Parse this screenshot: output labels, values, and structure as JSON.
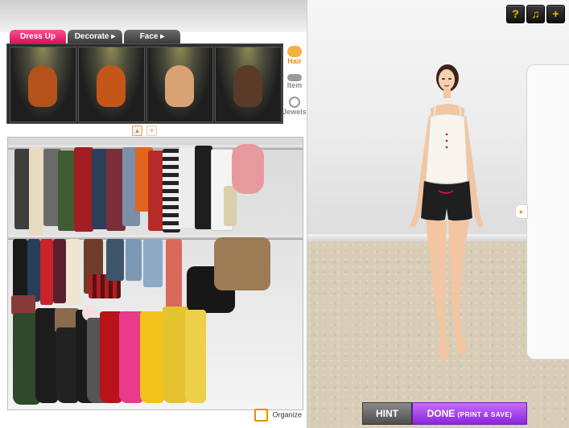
{
  "toolbar": {
    "help_label": "?",
    "music_label": "♫",
    "add_label": "+"
  },
  "tabs": [
    {
      "label": "Dress Up",
      "active": true
    },
    {
      "label": "Decorate",
      "arrow": "▸"
    },
    {
      "label": "Face",
      "arrow": "▸"
    }
  ],
  "categories": [
    {
      "label": "Hair",
      "icon": "hair-icon",
      "active": true
    },
    {
      "label": "Item",
      "icon": "hat-icon"
    },
    {
      "label": "Jewels",
      "icon": "ring-icon"
    }
  ],
  "hair_colors": [
    "#b5521c",
    "#c4561a",
    "#d9a272",
    "#5b3a28"
  ],
  "scroll": {
    "up": "▲",
    "down": "▼"
  },
  "closet": {
    "organize_label": "Organize"
  },
  "buttons": {
    "hint_label": "HINT",
    "done_label": "DONE",
    "done_sub": "(PRINT & SAVE)"
  },
  "drawer": {
    "arrow": "▸"
  },
  "colors": {
    "accent_pink": "#d6125c",
    "done_purple": "#8a26d9",
    "orange": "#f08a10"
  }
}
